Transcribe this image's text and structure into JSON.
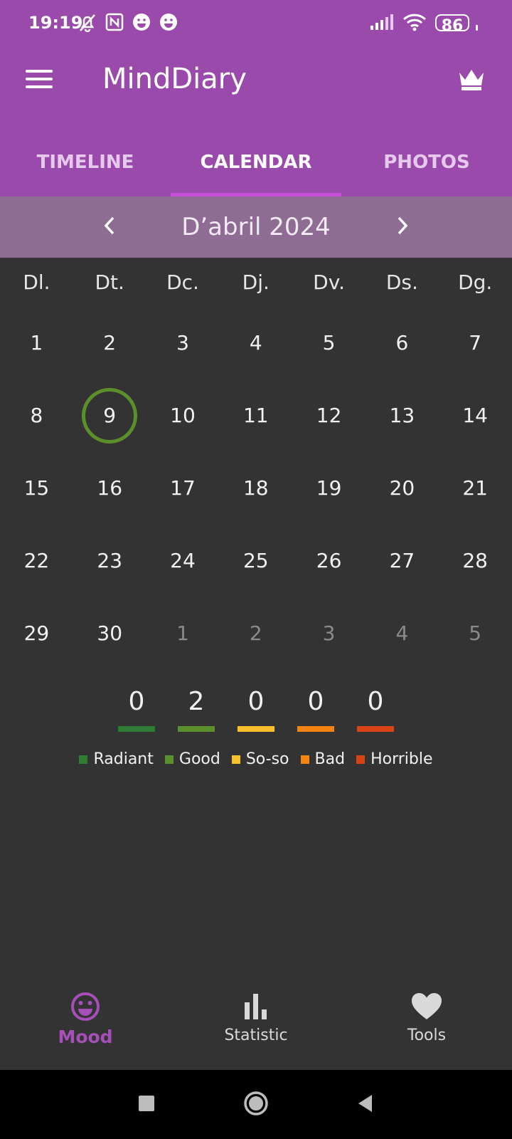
{
  "status_bar": {
    "time": "19:19",
    "battery": "86",
    "icons": [
      "bell-off-icon",
      "nfc-icon",
      "smile-icon",
      "smile-icon",
      "signal-icon",
      "wifi-icon",
      "battery-icon"
    ]
  },
  "app_bar": {
    "title": "MindDiary",
    "icons": [
      "menu-icon",
      "crown-icon"
    ]
  },
  "tabs": [
    {
      "label": "TIMELINE",
      "active": false
    },
    {
      "label": "CALENDAR",
      "active": true
    },
    {
      "label": "PHOTOS",
      "active": false
    }
  ],
  "month_nav": {
    "label": "D’abril 2024"
  },
  "weekdays": [
    "Dl.",
    "Dt.",
    "Dc.",
    "Dj.",
    "Dv.",
    "Ds.",
    "Dg."
  ],
  "weeks": [
    [
      "1",
      "2",
      "3",
      "4",
      "5",
      "6",
      "7"
    ],
    [
      "8",
      "9",
      "10",
      "11",
      "12",
      "13",
      "14"
    ],
    [
      "15",
      "16",
      "17",
      "18",
      "19",
      "20",
      "21"
    ],
    [
      "22",
      "23",
      "24",
      "25",
      "26",
      "27",
      "28"
    ],
    [
      "29",
      "30",
      "1",
      "2",
      "3",
      "4",
      "5"
    ]
  ],
  "highlighted_day": "9",
  "mood_counts": [
    {
      "name": "Radiant",
      "count": "0",
      "color": "#2e7d32"
    },
    {
      "name": "Good",
      "count": "2",
      "color": "#5b8f2b"
    },
    {
      "name": "So-so",
      "count": "0",
      "color": "#f9c02d"
    },
    {
      "name": "Bad",
      "count": "0",
      "color": "#f5830f"
    },
    {
      "name": "Horrible",
      "count": "0",
      "color": "#d84315"
    }
  ],
  "bottom_nav": [
    {
      "label": "Mood",
      "icon": "smile-icon",
      "active": true
    },
    {
      "label": "Statistic",
      "icon": "bar-chart-icon",
      "active": false
    },
    {
      "label": "Tools",
      "icon": "heart-icon",
      "active": false
    }
  ],
  "colors": {
    "primary": "#9a4aaa",
    "accent": "#a64fb9",
    "background": "#333333"
  }
}
